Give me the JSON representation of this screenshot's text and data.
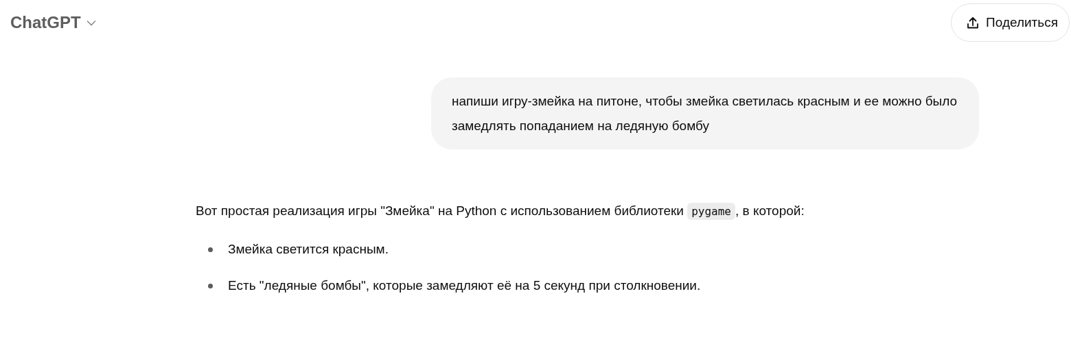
{
  "header": {
    "title": "ChatGPT",
    "share_button": "Поделиться"
  },
  "user_message": "напиши игру-змейка на питоне, чтобы змейка светилась красным и ее можно было замедлять попаданием на ледяную бомбу",
  "assistant_message": {
    "paragraph": [
      {
        "kind": "text",
        "text": "Вот простая реализация игры \"Змейка\" на Python с использованием библиотеки "
      },
      {
        "kind": "code",
        "text": "pygame"
      },
      {
        "kind": "text",
        "text": ", в которой:"
      }
    ],
    "bullets": [
      "Змейка светится красным.",
      "Есть \"ледяные бомбы\", которые замедляют её на 5 секунд при столкновении."
    ]
  }
}
